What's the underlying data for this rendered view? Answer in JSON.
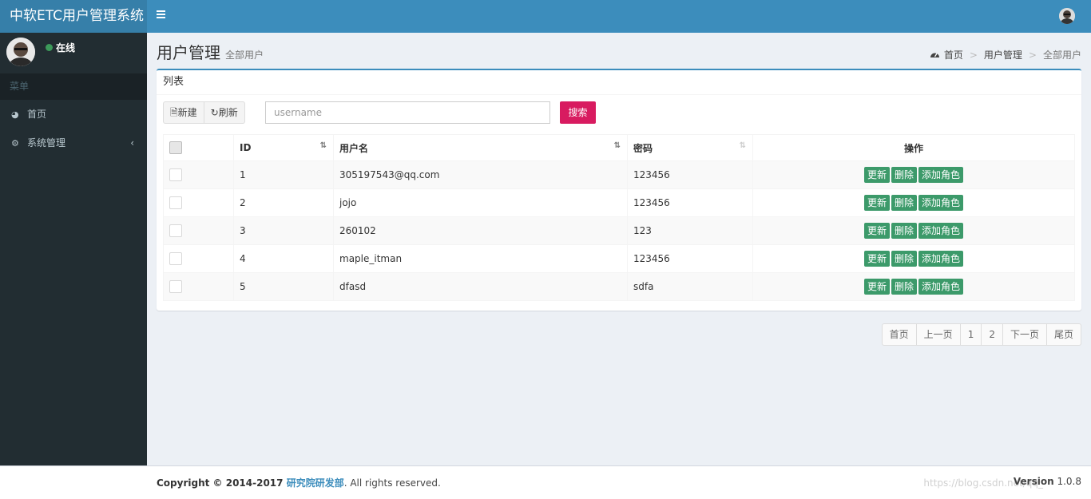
{
  "app": {
    "title": "中软ETC用户管理系统"
  },
  "sidebar": {
    "status": "在线",
    "menu_header": "菜单",
    "items": [
      {
        "label": "首页",
        "icon": "dashboard-icon"
      },
      {
        "label": "系统管理",
        "icon": "cogs-icon"
      }
    ]
  },
  "content": {
    "title": "用户管理",
    "subtitle": "全部用户",
    "breadcrumb": [
      "首页",
      "用户管理",
      "全部用户"
    ]
  },
  "box": {
    "title": "列表",
    "new_label": "新建",
    "refresh_label": "刷新",
    "search_placeholder": "username",
    "search_label": "搜索"
  },
  "table": {
    "headers": {
      "id": "ID",
      "username": "用户名",
      "password": "密码",
      "actions": "操作"
    },
    "actions": {
      "update": "更新",
      "delete": "删除",
      "add_role": "添加角色"
    },
    "rows": [
      {
        "id": "1",
        "username": "305197543@qq.com",
        "password": "123456"
      },
      {
        "id": "2",
        "username": "jojo",
        "password": "123456"
      },
      {
        "id": "3",
        "username": "260102",
        "password": "123"
      },
      {
        "id": "4",
        "username": "maple_itman",
        "password": "123456"
      },
      {
        "id": "5",
        "username": "dfasd",
        "password": "sdfa"
      }
    ]
  },
  "pagination": [
    "首页",
    "上一页",
    "1",
    "2",
    "下一页",
    "尾页"
  ],
  "footer": {
    "copyright_prefix": "Copyright © 2014-2017 ",
    "org": "研究院研发部",
    "copyright_suffix": ". All rights reserved.",
    "version_label": "Version",
    "version": "1.0.8",
    "watermark": "https://blog.csdn.net/qq_"
  },
  "colors": {
    "header": "#3c8dbc",
    "logo": "#367fa9",
    "sidebar": "#222d32",
    "search_button": "#d81b60",
    "action_button": "#3c9a6a"
  }
}
